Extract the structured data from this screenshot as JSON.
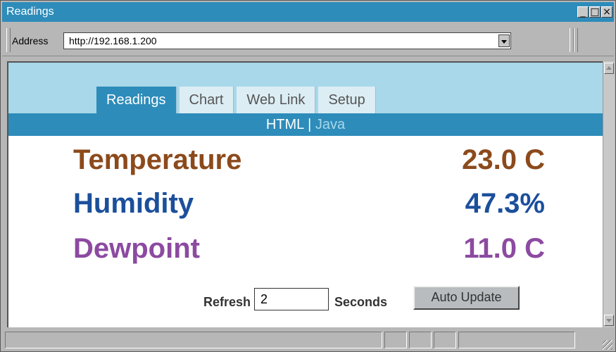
{
  "window": {
    "title": "Readings"
  },
  "address_bar": {
    "label": "Address",
    "url": "http://192.168.1.200"
  },
  "tabs": [
    {
      "label": "Readings",
      "active": true
    },
    {
      "label": "Chart",
      "active": false
    },
    {
      "label": "Web Link",
      "active": false
    },
    {
      "label": "Setup",
      "active": false
    }
  ],
  "subnav": {
    "html": "HTML",
    "separator": "|",
    "java": "Java"
  },
  "readings": {
    "temperature": {
      "label": "Temperature",
      "value": "23.0 C"
    },
    "humidity": {
      "label": "Humidity",
      "value": "47.3%"
    },
    "dewpoint": {
      "label": "Dewpoint",
      "value": "11.0 C"
    }
  },
  "refresh": {
    "label": "Refresh",
    "value": "2",
    "units": "Seconds",
    "button": "Auto Update"
  },
  "colors": {
    "titlebar": "#2d8cba",
    "header_band": "#a8d8ea",
    "temperature": "#8c4a1c",
    "humidity": "#1b4f9c",
    "dewpoint": "#8c4aa1"
  }
}
